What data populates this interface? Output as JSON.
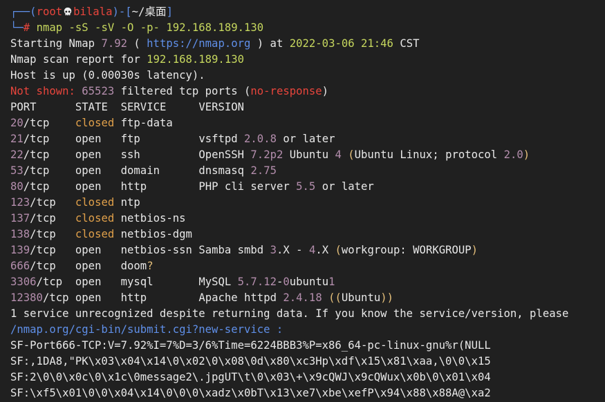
{
  "prompt": {
    "open": "┌──(",
    "user": "root",
    "host": "bilala",
    "close": ")-[",
    "dir": "~/桌面",
    "end": "]",
    "prefix": "└─",
    "hash": "#",
    "command": "nmap -sS -sV -O -p- 192.168.189.130"
  },
  "output": {
    "starting_prefix": "Starting Nmap ",
    "version": "7.92",
    "url_open": " ( ",
    "url": "https://nmap.org",
    "url_close": " ) at ",
    "date": "2022-03-06 21:46",
    "tz": " CST",
    "scan_report": "Nmap scan report for ",
    "ip": "192.168.189.130",
    "host_up": "Host is up (0.00030s latency).",
    "not_shown_label": "Not shown:",
    "not_shown_count": " 65523",
    "not_shown_rest": " filtered tcp ports (",
    "no_response": "no-response",
    "paren_close": ")"
  },
  "table": {
    "headers": [
      "PORT",
      "STATE",
      "SERVICE",
      "VERSION"
    ],
    "rows": [
      {
        "port": "20",
        "proto": "/tcp",
        "state": "closed",
        "service": "ftp-data",
        "version": ""
      },
      {
        "port": "21",
        "proto": "/tcp",
        "state": "open",
        "service": "ftp",
        "version": "vsftpd 2.0.8 or later"
      },
      {
        "port": "22",
        "proto": "/tcp",
        "state": "open",
        "service": "ssh",
        "version": "OpenSSH 7.2p2 Ubuntu 4 (Ubuntu Linux; protocol 2.0)"
      },
      {
        "port": "53",
        "proto": "/tcp",
        "state": "open",
        "service": "domain",
        "version": "dnsmasq 2.75"
      },
      {
        "port": "80",
        "proto": "/tcp",
        "state": "open",
        "service": "http",
        "version": "PHP cli server 5.5 or later"
      },
      {
        "port": "123",
        "proto": "/tcp",
        "state": "closed",
        "service": "ntp",
        "version": ""
      },
      {
        "port": "137",
        "proto": "/tcp",
        "state": "closed",
        "service": "netbios-ns",
        "version": ""
      },
      {
        "port": "138",
        "proto": "/tcp",
        "state": "closed",
        "service": "netbios-dgm",
        "version": ""
      },
      {
        "port": "139",
        "proto": "/tcp",
        "state": "open",
        "service": "netbios-ssn",
        "version": "Samba smbd 3.X - 4.X (workgroup: WORKGROUP)"
      },
      {
        "port": "666",
        "proto": "/tcp",
        "state": "open",
        "service": "doom?",
        "version": ""
      },
      {
        "port": "3306",
        "proto": "/tcp",
        "state": "open",
        "service": "mysql",
        "version": "MySQL 5.7.12-0ubuntu1"
      },
      {
        "port": "12380",
        "proto": "/tcp",
        "state": "open",
        "service": "http",
        "version": "Apache httpd 2.4.18 ((Ubuntu))"
      }
    ]
  },
  "footer": {
    "unrecognized": "1 service unrecognized despite returning data. If you know the service/version, please",
    "submit_url": "/nmap.org/cgi-bin/submit.cgi?new-service :",
    "sf1": "SF-Port666-TCP:V=7.92%I=7%D=3/6%Time=6224BBB3%P=x86_64-pc-linux-gnu%r(NULL",
    "sf2": "SF:,1DA8,\"PK\\x03\\x04\\x14\\0\\x02\\0\\x08\\0d\\x80\\xc3Hp\\xdf\\x15\\x81\\xaa,\\0\\0\\x15",
    "sf3": "SF:2\\0\\0\\x0c\\0\\x1c\\0message2\\.jpgUT\\t\\0\\x03\\+\\x9cQWJ\\x9cQWux\\x0b\\0\\x01\\x04",
    "sf4": "SF:\\xf5\\x01\\0\\0\\x04\\x14\\0\\0\\0\\xadz\\x0bT\\x13\\xe7\\xbe\\xefP\\x94\\x88\\x88A@\\xa2"
  },
  "icons": {
    "skull": "skull-icon"
  }
}
